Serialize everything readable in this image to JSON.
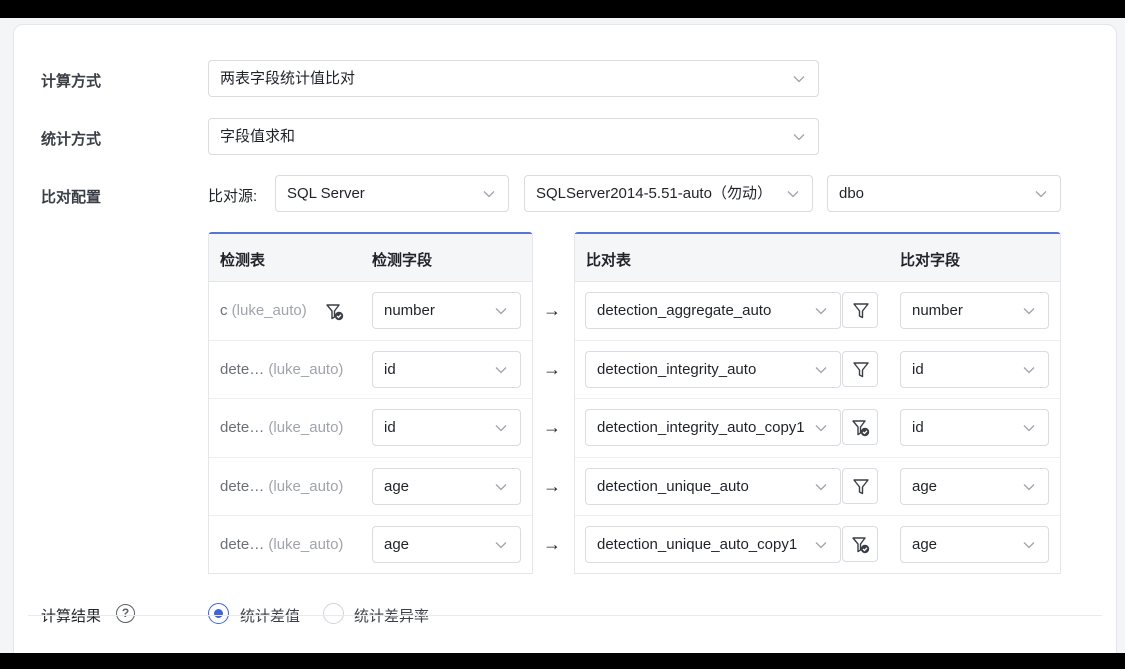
{
  "form": {
    "calc_method": {
      "label": "计算方式",
      "value": "两表字段统计值比对"
    },
    "stat_method": {
      "label": "统计方式",
      "value": "字段值求和"
    },
    "compare_config": {
      "label": "比对配置",
      "source_label": "比对源:",
      "source_type": "SQL Server",
      "datasource": "SQLServer2014-5.51-auto（勿动）",
      "schema": "dbo"
    },
    "result": {
      "label": "计算结果",
      "help": "?",
      "options": [
        {
          "label": "统计差值",
          "selected": true
        },
        {
          "label": "统计差异率",
          "selected": false
        }
      ]
    }
  },
  "mapping": {
    "headers": {
      "detect_table": "检测表",
      "detect_field": "检测字段",
      "compare_table": "比对表",
      "compare_field": "比对字段"
    },
    "arrow": "→",
    "rows": [
      {
        "detect_table": "c",
        "detect_schema": "(luke_auto)",
        "detect_filter": "funnel-check-icon",
        "detect_field": "number",
        "compare_table": "detection_aggregate_auto",
        "compare_filter": "funnel-icon",
        "compare_field": "number"
      },
      {
        "detect_table": "dete…",
        "detect_schema": "(luke_auto)",
        "detect_filter": "",
        "detect_field": "id",
        "compare_table": "detection_integrity_auto",
        "compare_filter": "funnel-icon",
        "compare_field": "id"
      },
      {
        "detect_table": "dete…",
        "detect_schema": "(luke_auto)",
        "detect_filter": "",
        "detect_field": "id",
        "compare_table": "detection_integrity_auto_copy1",
        "compare_filter": "funnel-check-icon",
        "compare_field": "id"
      },
      {
        "detect_table": "dete…",
        "detect_schema": "(luke_auto)",
        "detect_filter": "",
        "detect_field": "age",
        "compare_table": "detection_unique_auto",
        "compare_filter": "funnel-icon",
        "compare_field": "age"
      },
      {
        "detect_table": "dete…",
        "detect_schema": "(luke_auto)",
        "detect_filter": "",
        "detect_field": "age",
        "compare_table": "detection_unique_auto_copy1",
        "compare_filter": "funnel-check-icon",
        "compare_field": "age"
      }
    ]
  },
  "colors": {
    "accent": "#3f63d8",
    "panel_top": "#5673d6"
  }
}
